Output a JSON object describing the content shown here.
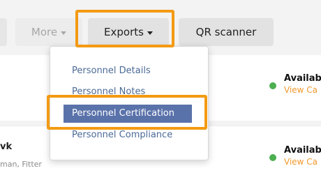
{
  "toolbar": {
    "more_label": "More",
    "exports_label": "Exports",
    "qr_label": "QR scanner"
  },
  "dropdown": {
    "items": [
      {
        "label": "Personnel Details"
      },
      {
        "label": "Personnel Notes"
      },
      {
        "label": "Personnel Certification"
      },
      {
        "label": "Personnel Compliance"
      }
    ],
    "selected_index": 2
  },
  "rows": [
    {
      "name": "",
      "subtitle": "",
      "status": "Availab",
      "link": "View Ca"
    },
    {
      "name": "vk",
      "subtitle": "man, Fitter",
      "status": "Availab",
      "link": "View Ca"
    }
  ],
  "colors": {
    "highlight": "#f39a12",
    "selected_item": "#5a72aa",
    "link": "#f0982b",
    "status_dot": "#4caf50"
  }
}
